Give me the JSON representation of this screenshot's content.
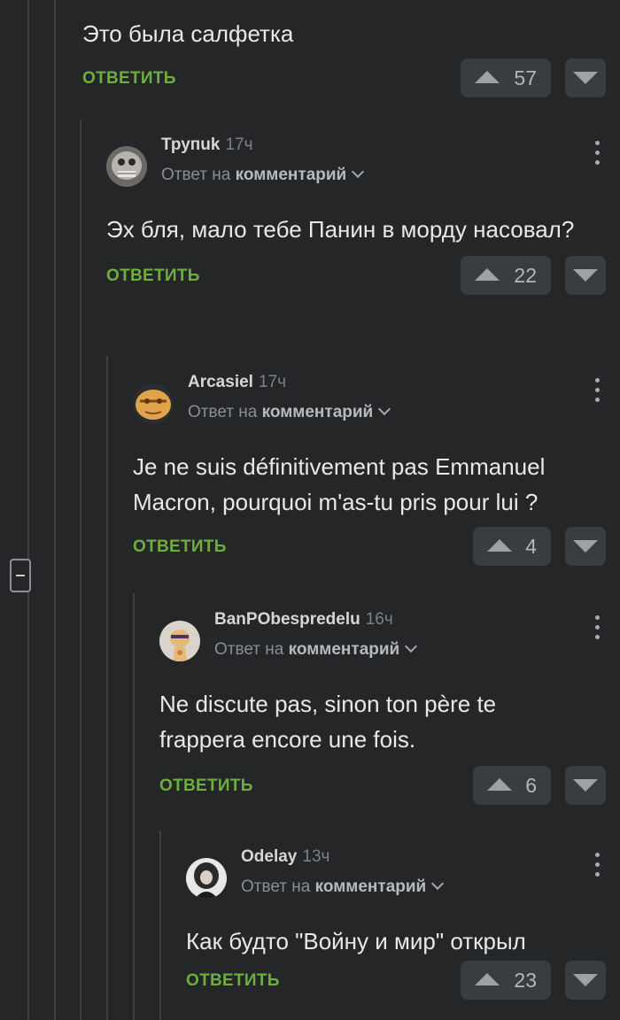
{
  "top_comment": {
    "text": "Это была салфетка",
    "reply_label": "ОТВЕТИТЬ",
    "votes": "57"
  },
  "comments": [
    {
      "username": "Трупuk",
      "time": "17ч",
      "reply_prefix": "Ответ на",
      "reply_target": "комментарий",
      "text": "Эх бля, мало тебе Панин в морду насовал?",
      "reply_label": "ОТВЕТИТЬ",
      "votes": "22"
    },
    {
      "username": "Arcasiel",
      "time": "17ч",
      "reply_prefix": "Ответ на",
      "reply_target": "комментарий",
      "text": "Je ne suis définitivement pas Emmanuel Macron, pourquoi m'as-tu pris pour lui ?",
      "reply_label": "ОТВЕТИТЬ",
      "votes": "4"
    },
    {
      "username": "BanPObespredelu",
      "time": "16ч",
      "reply_prefix": "Ответ на",
      "reply_target": "комментарий",
      "text": "Ne discute pas, sinon ton père te frappera encore une fois.",
      "reply_label": "ОТВЕТИТЬ",
      "votes": "6"
    },
    {
      "username": "Odelay",
      "time": "13ч",
      "reply_prefix": "Ответ на",
      "reply_target": "комментарий",
      "text": "Как будто \"Войну и мир\" открыл",
      "reply_label": "ОТВЕТИТЬ",
      "votes": "23"
    }
  ],
  "colors": {
    "background": "#242628",
    "accent_green": "#6eae3f",
    "vote_button": "#3a3d40"
  }
}
